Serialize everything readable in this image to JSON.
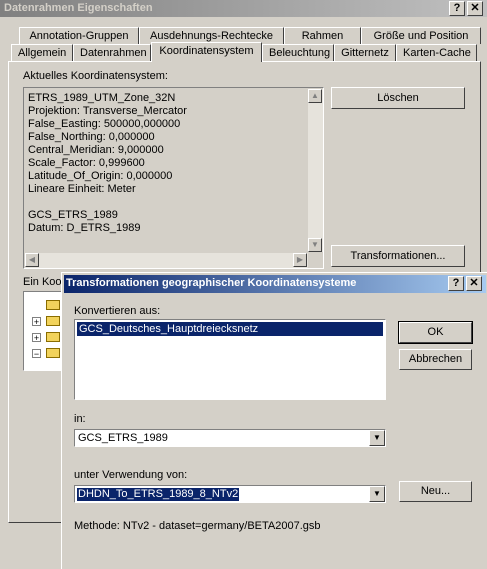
{
  "main_window": {
    "title": "Datenrahmen Eigenschaften",
    "help_btn": "?",
    "close_btn": "✕",
    "tabs_row1": [
      "Annotation-Gruppen",
      "Ausdehnungs-Rechtecke",
      "Rahmen",
      "Größe und Position"
    ],
    "tabs_row2": [
      "Allgemein",
      "Datenrahmen",
      "Koordinatensystem",
      "Beleuchtung",
      "Gitternetz",
      "Karten-Cache"
    ],
    "current_cs_label": "Aktuelles Koordinatensystem:",
    "cs_lines": [
      "ETRS_1989_UTM_Zone_32N",
      "Projektion: Transverse_Mercator",
      "False_Easting: 500000,000000",
      "False_Northing: 0,000000",
      "Central_Meridian: 9,000000",
      "Scale_Factor: 0,999600",
      "Latitude_Of_Origin: 0,000000",
      "Lineare Einheit: Meter",
      "",
      "GCS_ETRS_1989",
      "Datum: D_ETRS_1989"
    ],
    "delete_btn": "Löschen",
    "transform_btn": "Transformationen...",
    "select_cs_label": "Ein Koor"
  },
  "dialog": {
    "title": "Transformationen geographischer Koordinatensysteme",
    "help_btn": "?",
    "close_btn": "✕",
    "convert_from_label": "Konvertieren aus:",
    "convert_from_items": [
      "GCS_Deutsches_Hauptdreiecksnetz"
    ],
    "into_label": "in:",
    "into_value": "GCS_ETRS_1989",
    "using_label": "unter Verwendung von:",
    "using_value": "DHDN_To_ETRS_1989_8_NTv2",
    "method_text": "Methode:  NTv2 - dataset=germany/BETA2007.gsb",
    "ok_btn": "OK",
    "cancel_btn": "Abbrechen",
    "new_btn": "Neu..."
  }
}
